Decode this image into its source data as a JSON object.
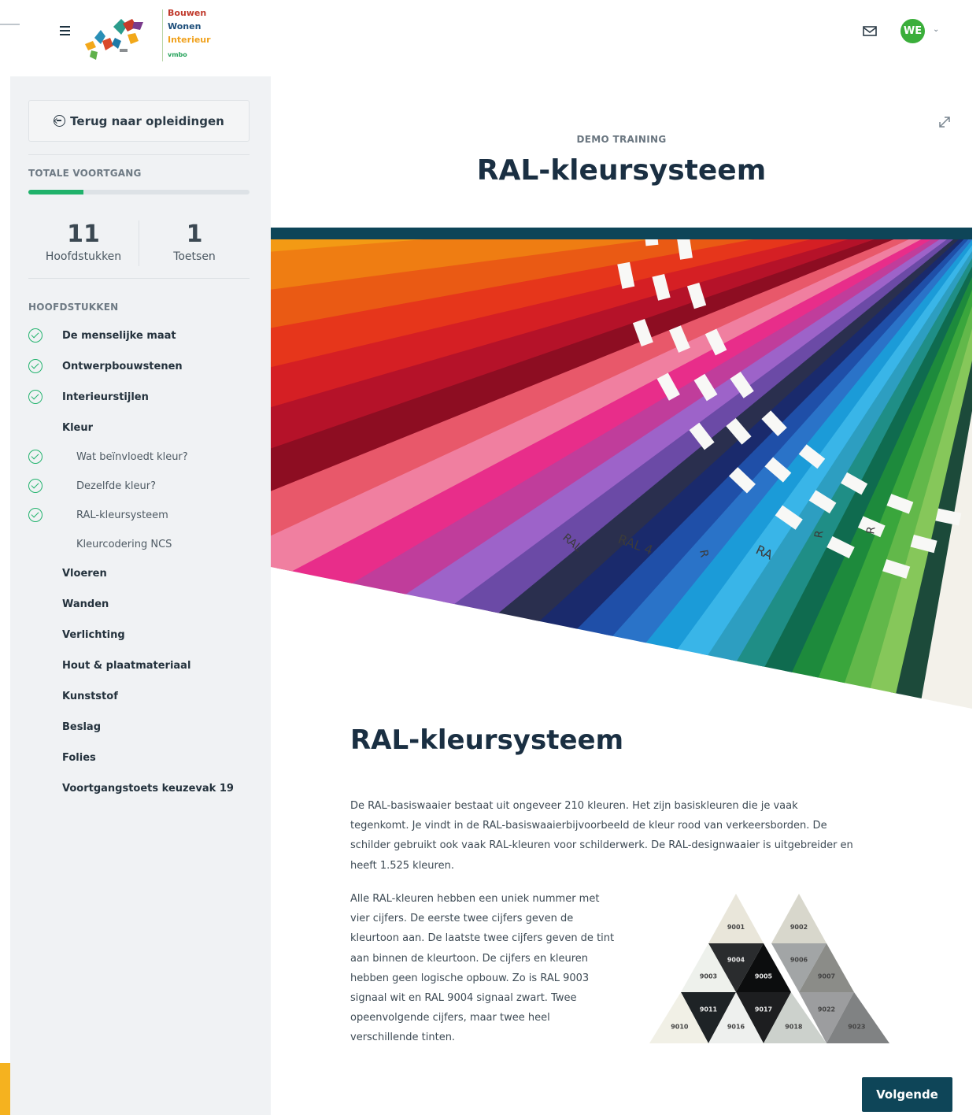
{
  "header": {
    "logo": {
      "line1": "Bouwen",
      "line2": "Wonen",
      "line3": "Interieur",
      "line4": "vmbo"
    },
    "avatar_initials": "WE"
  },
  "sidebar": {
    "back_label": "Terug naar opleidingen",
    "progress_label": "TOTALE VOORTGANG",
    "progress_fraction": 0.25,
    "stats": [
      {
        "value": "11",
        "label": "Hoofdstukken"
      },
      {
        "value": "1",
        "label": "Toetsen"
      }
    ],
    "chapters_label": "HOOFDSTUKKEN",
    "chapters": [
      {
        "label": "De menselijke maat",
        "done": true,
        "sub": false
      },
      {
        "label": "Ontwerpbouwstenen",
        "done": true,
        "sub": false
      },
      {
        "label": "Interieurstijlen",
        "done": true,
        "sub": false
      },
      {
        "label": "Kleur",
        "done": false,
        "sub": false
      },
      {
        "label": "Wat beïnvloedt kleur?",
        "done": true,
        "sub": true
      },
      {
        "label": "Dezelfde kleur?",
        "done": true,
        "sub": true
      },
      {
        "label": "RAL-kleursysteem",
        "done": true,
        "sub": true
      },
      {
        "label": "Kleurcodering NCS",
        "done": false,
        "sub": true
      },
      {
        "label": "Vloeren",
        "done": false,
        "sub": false
      },
      {
        "label": "Wanden",
        "done": false,
        "sub": false
      },
      {
        "label": "Verlichting",
        "done": false,
        "sub": false
      },
      {
        "label": "Hout & plaatmateriaal",
        "done": false,
        "sub": false
      },
      {
        "label": "Kunststof",
        "done": false,
        "sub": false
      },
      {
        "label": "Beslag",
        "done": false,
        "sub": false
      },
      {
        "label": "Folies",
        "done": false,
        "sub": false
      },
      {
        "label": "Voortgangstoets keuzevak 19",
        "done": false,
        "sub": false
      }
    ]
  },
  "main": {
    "kicker": "DEMO TRAINING",
    "title": "RAL-kleursysteem",
    "heading": "RAL-kleursysteem",
    "para1": [
      "De RAL-basiswaaier bestaat uit ongeveer 210 kleuren. Het zijn basiskleuren die je vaak",
      "tegenkomt. Je vindt in de RAL-basiswaaierbijvoorbeeld de kleur rood van verkeersborden. De",
      "schilder gebruikt ook vaak RAL-kleuren voor schilderwerk. De RAL-designwaaier is uitgebreider en",
      "heeft 1.525 kleuren."
    ],
    "para2": [
      "Alle RAL-kleuren hebben een uniek nummer met",
      "vier cijfers. De eerste twee cijfers geven de",
      "kleurtoon aan. De laatste twee cijfers geven de tint",
      "aan binnen de kleurtoon. De cijfers en kleuren",
      "hebben geen logische opbouw. Zo is RAL 9003",
      "signaal wit en RAL 9004 signaal zwart. Twee",
      "opeenvolgende cijfers, maar twee heel",
      "verschillende tinten."
    ],
    "next_label": "Volgende",
    "swatch_labels": {
      "s1": "RAL 4",
      "s2": "RAL",
      "s3": "R",
      "s4": "R",
      "s5": "R",
      "s6": "RA"
    },
    "triangle": [
      {
        "code": "9001",
        "color": "#e9e6da"
      },
      {
        "code": "9002",
        "color": "#d8d7cc"
      },
      {
        "code": "9003",
        "color": "#eef1ec"
      },
      {
        "code": "9004",
        "color": "#2a2c2e"
      },
      {
        "code": "9005",
        "color": "#0c0d0e"
      },
      {
        "code": "9006",
        "color": "#a2a5a6"
      },
      {
        "code": "9007",
        "color": "#8b8c88"
      },
      {
        "code": "9010",
        "color": "#f1f0e6"
      },
      {
        "code": "9011",
        "color": "#1e2326"
      },
      {
        "code": "9016",
        "color": "#eef0ee"
      },
      {
        "code": "9017",
        "color": "#1d1e20"
      },
      {
        "code": "9018",
        "color": "#ccd1cc"
      },
      {
        "code": "9022",
        "color": "#9c9d9f"
      },
      {
        "code": "9023",
        "color": "#808283"
      }
    ]
  }
}
